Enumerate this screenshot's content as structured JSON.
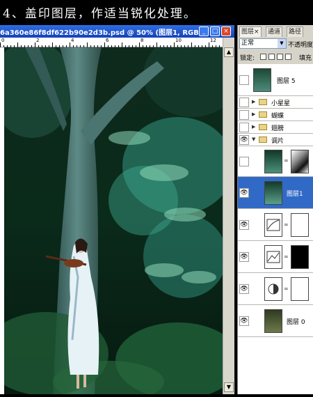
{
  "header": {
    "step_text": "4、盖印图层，作适当锐化处理。"
  },
  "document": {
    "title": "6a360e86f8df622b90e2d3b.psd @ 50% (图层1, RGB...",
    "ruler_labels": [
      "0",
      "2",
      "4",
      "6",
      "8",
      "10",
      "12"
    ],
    "controls": {
      "minimize": "_",
      "restore": "□",
      "close": "×"
    }
  },
  "panel": {
    "tabs": [
      "图层",
      "通道",
      "路径"
    ],
    "tab_close": "×",
    "blend_mode": "正常",
    "opacity_label": "不透明度",
    "lock_label": "锁定:",
    "fill_label": "填充",
    "layers": [
      {
        "name": "图层 5",
        "type": "layer",
        "visible": false
      },
      {
        "name": "小星星",
        "type": "group",
        "visible": false
      },
      {
        "name": "蝴蝶",
        "type": "group",
        "visible": false
      },
      {
        "name": "翅膀",
        "type": "group",
        "visible": false
      },
      {
        "name": "调片",
        "type": "group",
        "visible": true,
        "expanded": true
      },
      {
        "name": "",
        "type": "masked-layer",
        "visible": false
      },
      {
        "name": "图层1",
        "type": "layer",
        "visible": true,
        "selected": true
      },
      {
        "name": "",
        "type": "adjustment",
        "visible": true
      },
      {
        "name": "",
        "type": "adjustment",
        "visible": true
      },
      {
        "name": "",
        "type": "adjustment",
        "visible": true
      },
      {
        "name": "图层 0",
        "type": "layer",
        "visible": true
      }
    ],
    "eye_glyph": "👁",
    "collapsed_glyph": "▶",
    "expanded_glyph": "▼"
  },
  "colors": {
    "selection": "#3169c6",
    "titlebar": "#1541b8",
    "panel_bg": "#d6d3c9"
  }
}
